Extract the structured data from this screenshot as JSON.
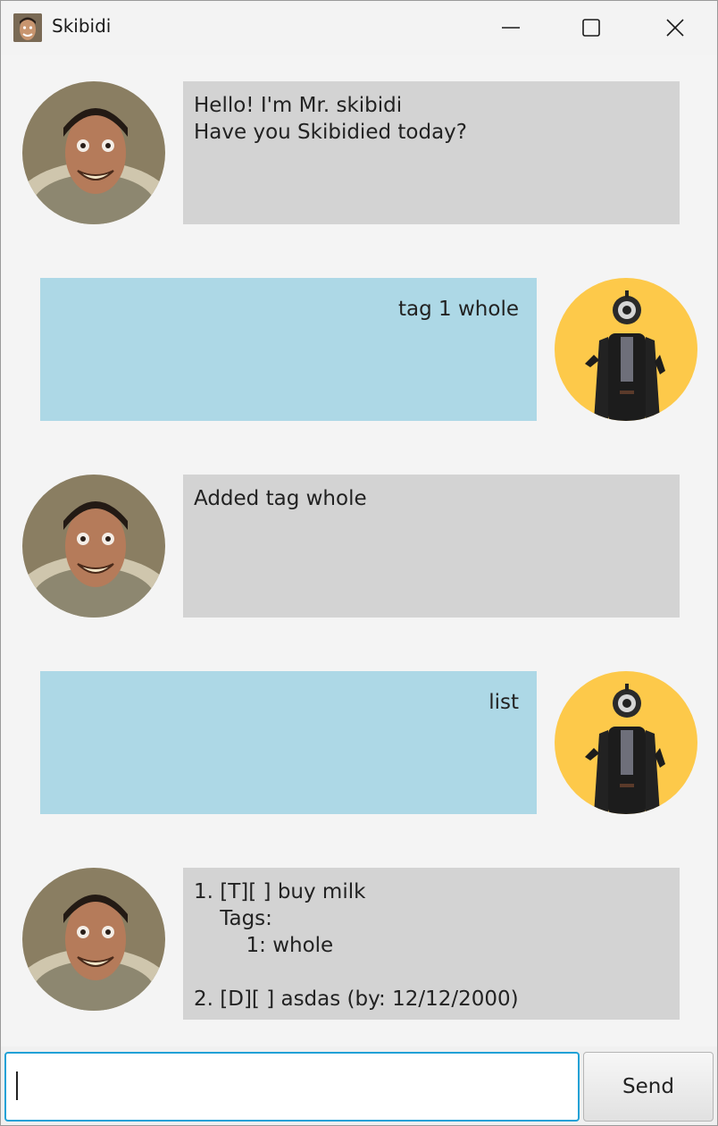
{
  "window": {
    "title": "Skibidi",
    "icon": "skibidi-app-icon",
    "controls": [
      "minimize-icon",
      "maximize-icon",
      "close-icon"
    ]
  },
  "messages": [
    {
      "sender": "bot",
      "avatar": "skibidi-toilet-avatar",
      "text": "Hello! I'm Mr. skibidi\nHave you Skibidied today?"
    },
    {
      "sender": "user",
      "avatar": "cameraman-avatar",
      "text": "tag 1 whole"
    },
    {
      "sender": "bot",
      "avatar": "skibidi-toilet-avatar",
      "text": "Added tag whole"
    },
    {
      "sender": "user",
      "avatar": "cameraman-avatar",
      "text": "list"
    },
    {
      "sender": "bot",
      "avatar": "skibidi-toilet-avatar",
      "text": "1. [T][ ] buy milk\n    Tags:\n        1: whole\n\n2. [D][ ] asdas (by: 12/12/2000)"
    }
  ],
  "input": {
    "value": "",
    "send_label": "Send"
  },
  "colors": {
    "bot_bubble": "#d3d3d3",
    "user_bubble": "#add8e6",
    "user_avatar_bg": "#fdc94a",
    "input_focus": "#21a1d6"
  }
}
